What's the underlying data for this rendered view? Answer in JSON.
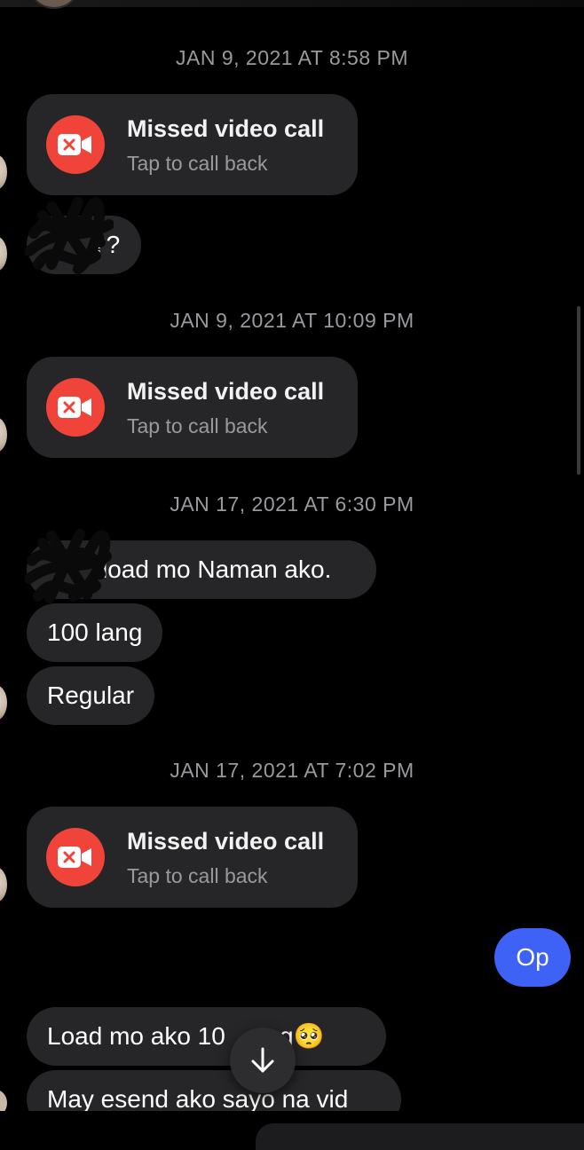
{
  "messages": [
    {
      "kind": "timestamp",
      "text": "JAN 9, 2021 AT 8:58 PM"
    },
    {
      "kind": "missed_call",
      "title": "Missed video call",
      "subtitle": "Tap to call back"
    },
    {
      "kind": "received",
      "text": "??"
    },
    {
      "kind": "timestamp",
      "text": "JAN 9, 2021 AT 10:09 PM"
    },
    {
      "kind": "missed_call",
      "title": "Missed video call",
      "subtitle": "Tap to call back"
    },
    {
      "kind": "timestamp",
      "text": "JAN 17, 2021 AT 6:30 PM"
    },
    {
      "kind": "received",
      "text": "load mo Naman ako."
    },
    {
      "kind": "received",
      "text": "100 lang"
    },
    {
      "kind": "received",
      "text": "Regular"
    },
    {
      "kind": "timestamp",
      "text": "JAN 17, 2021 AT 7:02 PM"
    },
    {
      "kind": "missed_call",
      "title": "Missed video call",
      "subtitle": "Tap to call back"
    },
    {
      "kind": "sent",
      "text": "Op"
    },
    {
      "kind": "received",
      "text": "Load mo ako 10",
      "suffix": "ang🥺"
    },
    {
      "kind": "received",
      "text": "May esend ako sayo na vid"
    }
  ],
  "icons": {
    "missed_call": "video-camera-x-icon",
    "scroll": "arrow-down-icon"
  },
  "colors": {
    "background": "#000000",
    "received_bubble": "#262628",
    "sent_bubble": "#3d62f5",
    "missed_call_icon": "#f0443a",
    "timestamp": "#9a9a9e"
  }
}
